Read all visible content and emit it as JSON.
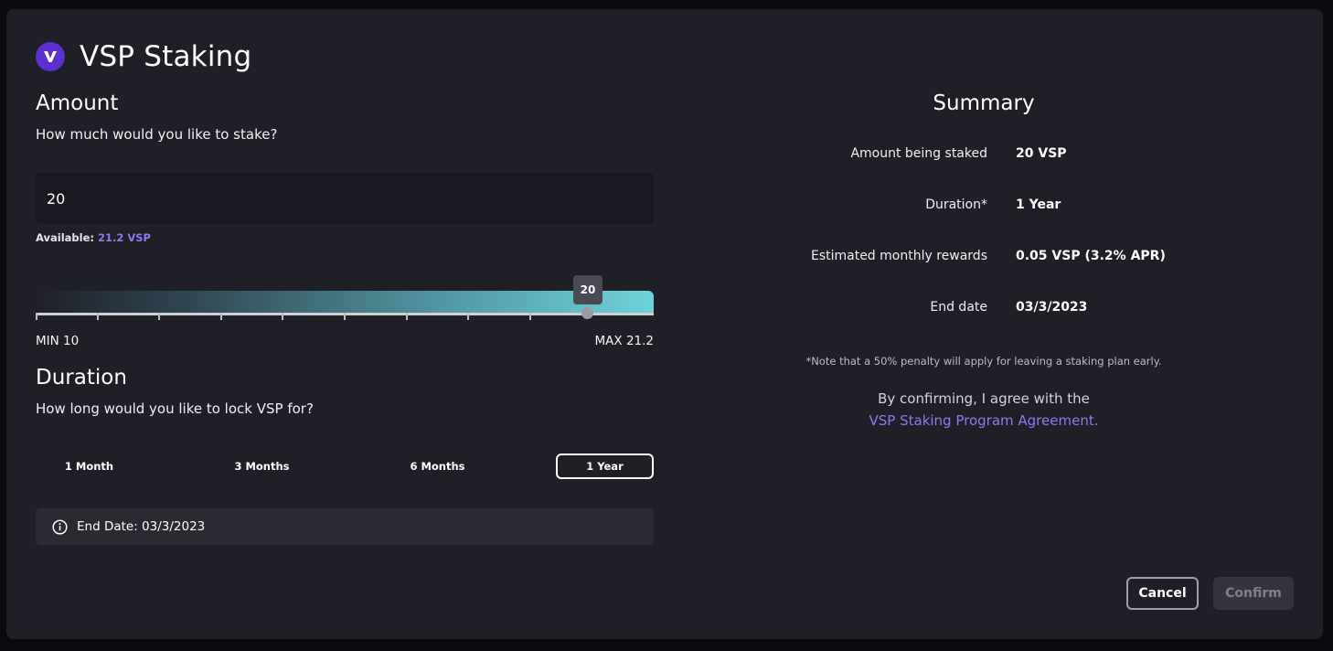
{
  "header": {
    "title": "VSP Staking",
    "logo_icon": "vesper-logo-icon"
  },
  "amount": {
    "title": "Amount",
    "question": "How much would you like to stake?",
    "input_value": "20",
    "available_label": "Available:",
    "available_value": "21.2 VSP",
    "slider": {
      "value": 20,
      "bubble": "20",
      "min": 10,
      "max": 21.2,
      "min_label": "MIN 10",
      "max_label": "MAX 21.2"
    }
  },
  "duration": {
    "title": "Duration",
    "question": "How long would you like to lock VSP for?",
    "options": [
      {
        "label": "1 Month"
      },
      {
        "label": "3 Months"
      },
      {
        "label": "6 Months"
      },
      {
        "label": "1 Year",
        "selected": true
      }
    ],
    "end_date_text": "End Date: 03/3/2023"
  },
  "summary": {
    "title": "Summary",
    "rows": [
      {
        "label": "Amount being staked",
        "value": "20 VSP"
      },
      {
        "label": "Duration*",
        "value": "1 Year"
      },
      {
        "label": "Estimated monthly rewards",
        "value": "0.05 VSP (3.2% APR)"
      },
      {
        "label": "End date",
        "value": "03/3/2023"
      }
    ],
    "note": "*Note that a 50% penalty will apply for leaving a staking plan early.",
    "agree_text": "By confirming, I agree with the",
    "agree_link": "VSP Staking Program Agreement."
  },
  "footer": {
    "cancel_label": "Cancel",
    "confirm_label": "Confirm"
  },
  "colors": {
    "accent": "#8b7bf0",
    "logo_bg": "#5b2fd0",
    "modal_bg": "#1f1f28"
  }
}
